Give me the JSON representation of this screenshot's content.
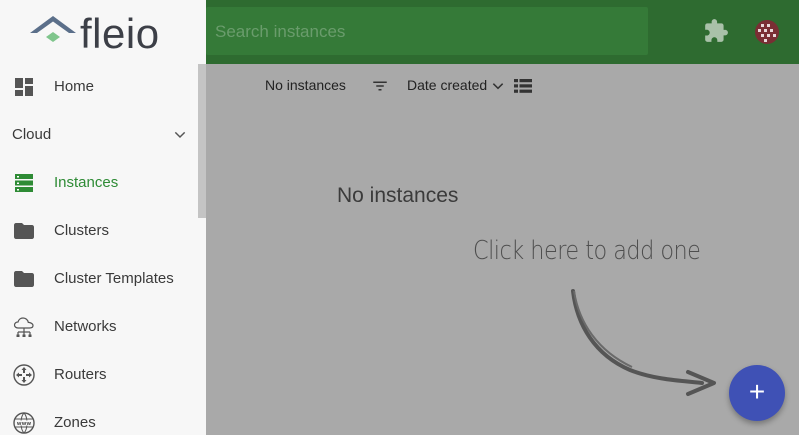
{
  "brand": {
    "name": "fleio"
  },
  "header": {
    "search_placeholder": "Search instances",
    "icons": [
      "puzzle-icon",
      "avatar"
    ]
  },
  "sidebar": {
    "items": [
      {
        "label": "Home",
        "icon": "dashboard-icon",
        "active": false
      },
      {
        "label": "Cloud",
        "icon": "chevron-down-icon",
        "section": true
      },
      {
        "label": "Instances",
        "icon": "server-icon",
        "active": true
      },
      {
        "label": "Clusters",
        "icon": "folder-icon",
        "active": false
      },
      {
        "label": "Cluster Templates",
        "icon": "folder-icon",
        "active": false
      },
      {
        "label": "Networks",
        "icon": "cloud-network-icon",
        "active": false
      },
      {
        "label": "Routers",
        "icon": "router-icon",
        "active": false
      },
      {
        "label": "Zones",
        "icon": "www-icon",
        "active": false
      }
    ]
  },
  "toolbar": {
    "count_label": "No instances",
    "sort_label": "Date created",
    "icons": [
      "filter-icon",
      "chevron-down-icon",
      "list-view-icon"
    ]
  },
  "main": {
    "empty_title": "No instances",
    "hint": "Click here to add one"
  },
  "fab": {
    "label": "+"
  },
  "colors": {
    "header": "#2e6b30",
    "search": "#357a38",
    "active": "#2e8b35",
    "fab": "#3f51b5",
    "overlay": "#a9a9a9"
  }
}
